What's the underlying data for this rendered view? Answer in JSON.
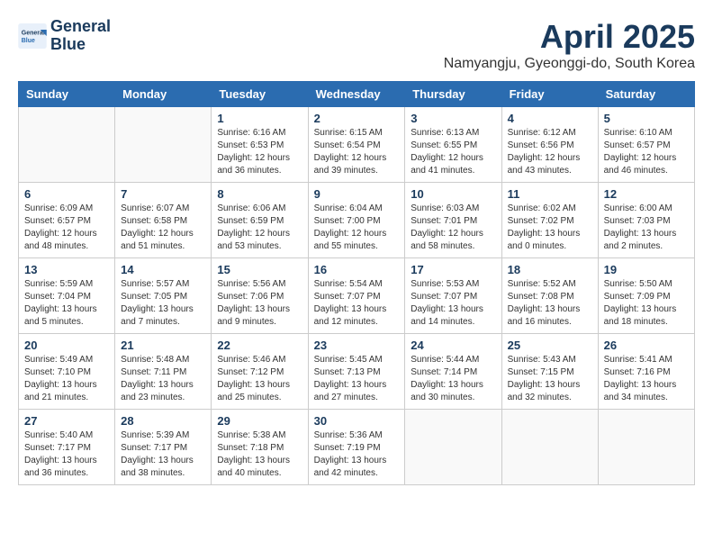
{
  "header": {
    "logo_line1": "General",
    "logo_line2": "Blue",
    "month": "April 2025",
    "location": "Namyangju, Gyeonggi-do, South Korea"
  },
  "weekdays": [
    "Sunday",
    "Monday",
    "Tuesday",
    "Wednesday",
    "Thursday",
    "Friday",
    "Saturday"
  ],
  "weeks": [
    [
      {
        "day": "",
        "info": ""
      },
      {
        "day": "",
        "info": ""
      },
      {
        "day": "1",
        "info": "Sunrise: 6:16 AM\nSunset: 6:53 PM\nDaylight: 12 hours\nand 36 minutes."
      },
      {
        "day": "2",
        "info": "Sunrise: 6:15 AM\nSunset: 6:54 PM\nDaylight: 12 hours\nand 39 minutes."
      },
      {
        "day": "3",
        "info": "Sunrise: 6:13 AM\nSunset: 6:55 PM\nDaylight: 12 hours\nand 41 minutes."
      },
      {
        "day": "4",
        "info": "Sunrise: 6:12 AM\nSunset: 6:56 PM\nDaylight: 12 hours\nand 43 minutes."
      },
      {
        "day": "5",
        "info": "Sunrise: 6:10 AM\nSunset: 6:57 PM\nDaylight: 12 hours\nand 46 minutes."
      }
    ],
    [
      {
        "day": "6",
        "info": "Sunrise: 6:09 AM\nSunset: 6:57 PM\nDaylight: 12 hours\nand 48 minutes."
      },
      {
        "day": "7",
        "info": "Sunrise: 6:07 AM\nSunset: 6:58 PM\nDaylight: 12 hours\nand 51 minutes."
      },
      {
        "day": "8",
        "info": "Sunrise: 6:06 AM\nSunset: 6:59 PM\nDaylight: 12 hours\nand 53 minutes."
      },
      {
        "day": "9",
        "info": "Sunrise: 6:04 AM\nSunset: 7:00 PM\nDaylight: 12 hours\nand 55 minutes."
      },
      {
        "day": "10",
        "info": "Sunrise: 6:03 AM\nSunset: 7:01 PM\nDaylight: 12 hours\nand 58 minutes."
      },
      {
        "day": "11",
        "info": "Sunrise: 6:02 AM\nSunset: 7:02 PM\nDaylight: 13 hours\nand 0 minutes."
      },
      {
        "day": "12",
        "info": "Sunrise: 6:00 AM\nSunset: 7:03 PM\nDaylight: 13 hours\nand 2 minutes."
      }
    ],
    [
      {
        "day": "13",
        "info": "Sunrise: 5:59 AM\nSunset: 7:04 PM\nDaylight: 13 hours\nand 5 minutes."
      },
      {
        "day": "14",
        "info": "Sunrise: 5:57 AM\nSunset: 7:05 PM\nDaylight: 13 hours\nand 7 minutes."
      },
      {
        "day": "15",
        "info": "Sunrise: 5:56 AM\nSunset: 7:06 PM\nDaylight: 13 hours\nand 9 minutes."
      },
      {
        "day": "16",
        "info": "Sunrise: 5:54 AM\nSunset: 7:07 PM\nDaylight: 13 hours\nand 12 minutes."
      },
      {
        "day": "17",
        "info": "Sunrise: 5:53 AM\nSunset: 7:07 PM\nDaylight: 13 hours\nand 14 minutes."
      },
      {
        "day": "18",
        "info": "Sunrise: 5:52 AM\nSunset: 7:08 PM\nDaylight: 13 hours\nand 16 minutes."
      },
      {
        "day": "19",
        "info": "Sunrise: 5:50 AM\nSunset: 7:09 PM\nDaylight: 13 hours\nand 18 minutes."
      }
    ],
    [
      {
        "day": "20",
        "info": "Sunrise: 5:49 AM\nSunset: 7:10 PM\nDaylight: 13 hours\nand 21 minutes."
      },
      {
        "day": "21",
        "info": "Sunrise: 5:48 AM\nSunset: 7:11 PM\nDaylight: 13 hours\nand 23 minutes."
      },
      {
        "day": "22",
        "info": "Sunrise: 5:46 AM\nSunset: 7:12 PM\nDaylight: 13 hours\nand 25 minutes."
      },
      {
        "day": "23",
        "info": "Sunrise: 5:45 AM\nSunset: 7:13 PM\nDaylight: 13 hours\nand 27 minutes."
      },
      {
        "day": "24",
        "info": "Sunrise: 5:44 AM\nSunset: 7:14 PM\nDaylight: 13 hours\nand 30 minutes."
      },
      {
        "day": "25",
        "info": "Sunrise: 5:43 AM\nSunset: 7:15 PM\nDaylight: 13 hours\nand 32 minutes."
      },
      {
        "day": "26",
        "info": "Sunrise: 5:41 AM\nSunset: 7:16 PM\nDaylight: 13 hours\nand 34 minutes."
      }
    ],
    [
      {
        "day": "27",
        "info": "Sunrise: 5:40 AM\nSunset: 7:17 PM\nDaylight: 13 hours\nand 36 minutes."
      },
      {
        "day": "28",
        "info": "Sunrise: 5:39 AM\nSunset: 7:17 PM\nDaylight: 13 hours\nand 38 minutes."
      },
      {
        "day": "29",
        "info": "Sunrise: 5:38 AM\nSunset: 7:18 PM\nDaylight: 13 hours\nand 40 minutes."
      },
      {
        "day": "30",
        "info": "Sunrise: 5:36 AM\nSunset: 7:19 PM\nDaylight: 13 hours\nand 42 minutes."
      },
      {
        "day": "",
        "info": ""
      },
      {
        "day": "",
        "info": ""
      },
      {
        "day": "",
        "info": ""
      }
    ]
  ]
}
